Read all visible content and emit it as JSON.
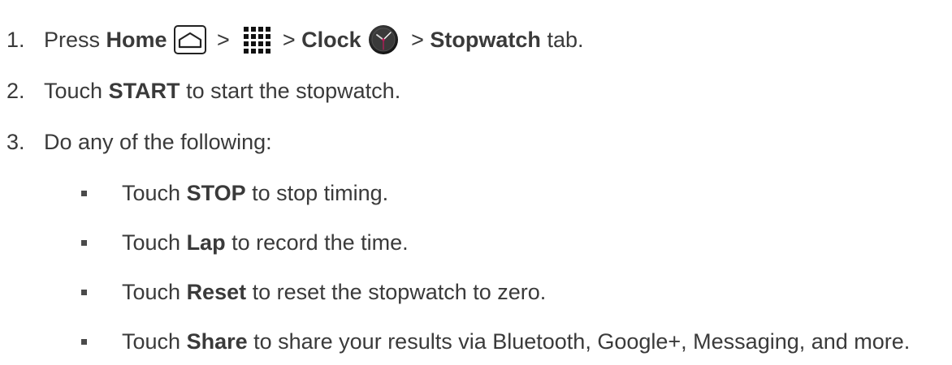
{
  "steps": [
    {
      "number": "1.",
      "press": "Press ",
      "home": "Home",
      "gt1": " > ",
      "gt2": " > ",
      "clock": "Clock",
      "gt3": " > ",
      "stopwatch": "Stopwatch",
      "tab": " tab."
    },
    {
      "number": "2.",
      "touch": "Touch ",
      "start": "START",
      "rest": " to start the stopwatch."
    },
    {
      "number": "3.",
      "text": "Do any of the following:"
    }
  ],
  "bullets": [
    {
      "touch": "Touch ",
      "keyword": "STOP",
      "rest": " to stop timing."
    },
    {
      "touch": "Touch ",
      "keyword": "Lap",
      "rest": " to record the time."
    },
    {
      "touch": "Touch ",
      "keyword": "Reset",
      "rest": " to reset the stopwatch to zero."
    },
    {
      "touch": "Touch ",
      "keyword": "Share",
      "rest": " to share your results via Bluetooth, Google+, Messaging, and more."
    }
  ],
  "icons": {
    "home": "home-key-icon",
    "apps": "apps-grid-icon",
    "clock": "clock-app-icon"
  }
}
